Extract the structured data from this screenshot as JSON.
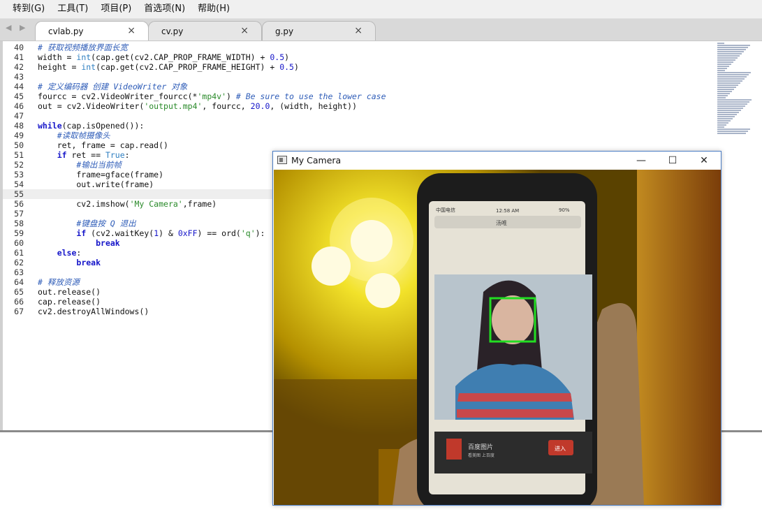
{
  "menu": {
    "items": [
      "转到(G)",
      "工具(T)",
      "项目(P)",
      "首选项(N)",
      "帮助(H)"
    ]
  },
  "tabs": [
    {
      "label": "cvlab.py",
      "active": true
    },
    {
      "label": "cv.py",
      "active": false
    },
    {
      "label": "g.py",
      "active": false
    }
  ],
  "tab_close_glyph": "×",
  "editor": {
    "current_line": "55",
    "lines": [
      {
        "n": "40",
        "segments": [
          [
            "cm",
            "# 获取视频播放界面长宽"
          ]
        ]
      },
      {
        "n": "41",
        "segments": [
          [
            "",
            "width = "
          ],
          [
            "bi",
            "int"
          ],
          [
            "",
            "(cap.get(cv2.CAP_PROP_FRAME_WIDTH) + "
          ],
          [
            "num",
            "0.5"
          ],
          [
            "",
            ")"
          ]
        ]
      },
      {
        "n": "42",
        "segments": [
          [
            "",
            "height = "
          ],
          [
            "bi",
            "int"
          ],
          [
            "",
            "(cap.get(cv2.CAP_PROP_FRAME_HEIGHT) + "
          ],
          [
            "num",
            "0.5"
          ],
          [
            "",
            ")"
          ]
        ]
      },
      {
        "n": "43",
        "segments": []
      },
      {
        "n": "44",
        "segments": [
          [
            "cm",
            "# 定义编码器 创建 VideoWriter 对象"
          ]
        ]
      },
      {
        "n": "45",
        "segments": [
          [
            "",
            "fourcc = cv2.VideoWriter_fourcc(*"
          ],
          [
            "str",
            "'mp4v'"
          ],
          [
            "",
            ") "
          ],
          [
            "cm",
            "# Be sure to use the lower case"
          ]
        ]
      },
      {
        "n": "46",
        "segments": [
          [
            "",
            "out = cv2.VideoWriter("
          ],
          [
            "str",
            "'output.mp4'"
          ],
          [
            "",
            ", fourcc, "
          ],
          [
            "num",
            "20.0"
          ],
          [
            "",
            ", (width, height))"
          ]
        ]
      },
      {
        "n": "47",
        "segments": []
      },
      {
        "n": "48",
        "segments": [
          [
            "kw",
            "while"
          ],
          [
            "",
            "(cap.isOpened()):"
          ]
        ]
      },
      {
        "n": "49",
        "segments": [
          [
            "",
            "    "
          ],
          [
            "cm",
            "#读取帧摄像头"
          ]
        ]
      },
      {
        "n": "50",
        "segments": [
          [
            "",
            "    ret, frame = cap.read()"
          ]
        ]
      },
      {
        "n": "51",
        "segments": [
          [
            "",
            "    "
          ],
          [
            "kw",
            "if"
          ],
          [
            "",
            " ret == "
          ],
          [
            "bi",
            "True"
          ],
          [
            "",
            ":"
          ]
        ]
      },
      {
        "n": "52",
        "segments": [
          [
            "",
            "        "
          ],
          [
            "cm",
            "#输出当前帧"
          ]
        ]
      },
      {
        "n": "53",
        "segments": [
          [
            "",
            "        frame=gface(frame)"
          ]
        ]
      },
      {
        "n": "54",
        "segments": [
          [
            "",
            "        out.write(frame)"
          ]
        ]
      },
      {
        "n": "55",
        "segments": []
      },
      {
        "n": "56",
        "segments": [
          [
            "",
            "        cv2.imshow("
          ],
          [
            "str",
            "'My Camera'"
          ],
          [
            "",
            ",frame)"
          ]
        ]
      },
      {
        "n": "57",
        "segments": []
      },
      {
        "n": "58",
        "segments": [
          [
            "",
            "        "
          ],
          [
            "cm",
            "#键盘按 Q 退出"
          ]
        ]
      },
      {
        "n": "59",
        "segments": [
          [
            "",
            "        "
          ],
          [
            "kw",
            "if"
          ],
          [
            "",
            " (cv2.waitKey("
          ],
          [
            "num",
            "1"
          ],
          [
            "",
            ") & "
          ],
          [
            "num",
            "0xFF"
          ],
          [
            "",
            ") == ord("
          ],
          [
            "str",
            "'q'"
          ],
          [
            "",
            "):"
          ]
        ]
      },
      {
        "n": "60",
        "segments": [
          [
            "",
            "            "
          ],
          [
            "kw",
            "break"
          ]
        ]
      },
      {
        "n": "61",
        "segments": [
          [
            "",
            "    "
          ],
          [
            "kw",
            "else"
          ],
          [
            "",
            ":"
          ]
        ]
      },
      {
        "n": "62",
        "segments": [
          [
            "",
            "        "
          ],
          [
            "kw",
            "break"
          ]
        ]
      },
      {
        "n": "63",
        "segments": []
      },
      {
        "n": "64",
        "segments": [
          [
            "cm",
            "# 释放资源"
          ]
        ]
      },
      {
        "n": "65",
        "segments": [
          [
            "",
            "out.release()"
          ]
        ]
      },
      {
        "n": "66",
        "segments": [
          [
            "",
            "cap.release()"
          ]
        ]
      },
      {
        "n": "67",
        "segments": [
          [
            "",
            "cv2.destroyAllWindows()"
          ]
        ]
      }
    ]
  },
  "camera_window": {
    "title": "My Camera",
    "minimize_glyph": "—",
    "maximize_glyph": "☐",
    "close_glyph": "✕",
    "phone_status": {
      "carrier": "中国电信",
      "time": "12:58 AM",
      "battery": "90%"
    },
    "search_text": "汤唯",
    "ad_text": "百度图片",
    "ad_subtext": "看美图 上百度",
    "ad_button": "进入",
    "face_box_color": "#22dd22"
  }
}
